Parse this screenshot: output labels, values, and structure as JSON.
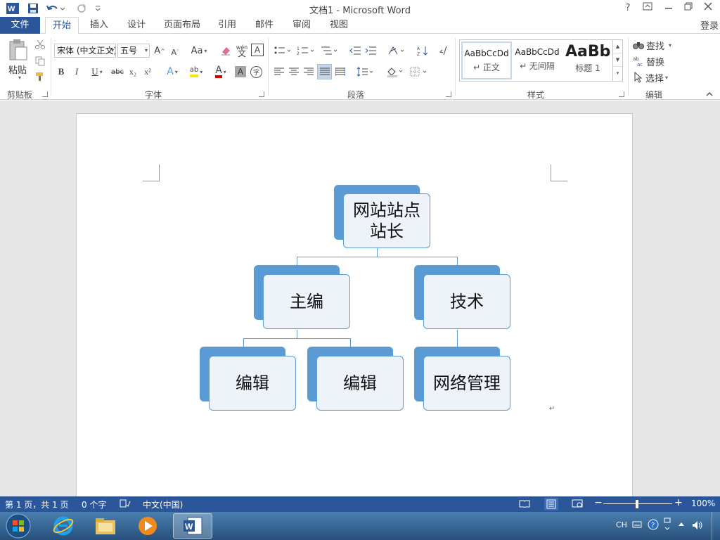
{
  "window": {
    "title": "文档1 - Microsoft Word",
    "help": "?",
    "login": "登录"
  },
  "tabs": [
    "文件",
    "开始",
    "插入",
    "设计",
    "页面布局",
    "引用",
    "邮件",
    "审阅",
    "视图"
  ],
  "ribbon": {
    "clipboard": {
      "paste": "粘贴",
      "group": "剪贴板"
    },
    "font": {
      "font_name": "宋体 (中文正文)",
      "font_size": "五号",
      "grow": "A",
      "shrink": "A",
      "case": "Aa",
      "phonetic": "wén",
      "border_char": "A",
      "bold": "B",
      "italic": "I",
      "underline": "U",
      "strike": "abc",
      "subscript": "x₂",
      "superscript": "x²",
      "text_effects": "A",
      "highlight": "ab",
      "font_color": "A",
      "char_shading": "A",
      "enclose": "字",
      "group": "字体"
    },
    "paragraph": {
      "group": "段落"
    },
    "styles": {
      "items": [
        {
          "sample": "AaBbCcDd",
          "name": "↵ 正文"
        },
        {
          "sample": "AaBbCcDd",
          "name": "↵ 无间隔"
        },
        {
          "sample": "AaBb",
          "name": "标题 1"
        }
      ],
      "group": "样式"
    },
    "editing": {
      "find": "查找",
      "replace": "替换",
      "select": "选择",
      "group": "编辑"
    }
  },
  "smartart": {
    "root": "网站站点站长",
    "level1": [
      "主编",
      "技术"
    ],
    "level2": [
      "编辑",
      "编辑",
      "网络管理"
    ]
  },
  "statusbar": {
    "page": "第 1 页，共 1 页",
    "words": "0 个字",
    "language": "中文(中国)",
    "zoom": "100%",
    "zoom_minus": "−",
    "zoom_plus": "+"
  },
  "taskbar": {
    "lang": "CH"
  },
  "colors": {
    "accent": "#2b579a",
    "smartart": "#5b9bd5",
    "node_fill": "#eef3fa"
  }
}
